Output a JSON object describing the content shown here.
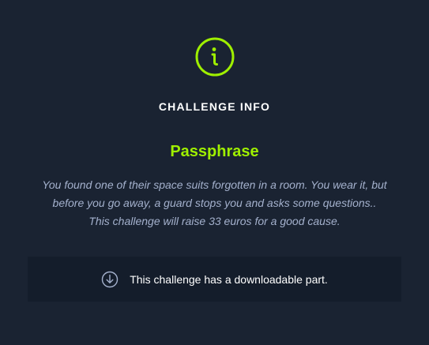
{
  "modal": {
    "header": "CHALLENGE INFO",
    "title": "Passphrase",
    "description_lines": [
      "You found one of their space suits forgotten in a room. You wear it, but",
      "before you go away, a guard stops you and asks some questions..",
      "This challenge will raise 33 euros for a good cause."
    ],
    "download_text": "This challenge has a downloadable part."
  },
  "colors": {
    "background": "#1a2332",
    "accent": "#9fef00",
    "panel": "#141d2b",
    "muted_text": "#a4b1cd"
  },
  "icons": {
    "info": "info-icon",
    "download": "download-icon"
  }
}
